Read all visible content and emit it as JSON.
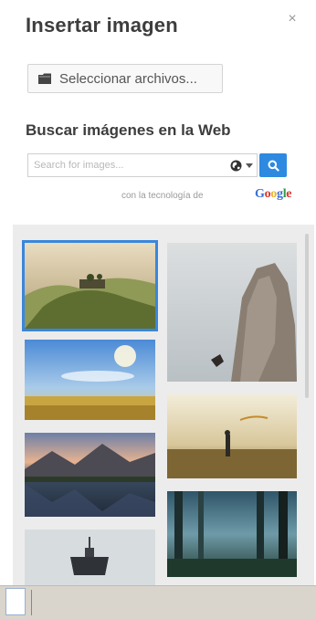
{
  "dialog": {
    "title": "Insertar imagen",
    "close_symbol": "×"
  },
  "upload": {
    "label": "Seleccionar archivos...",
    "icon": "folder-icon"
  },
  "web_search": {
    "heading": "Buscar imágenes en la Web",
    "placeholder": "Search for images...",
    "safe_search_icon": "globe-icon",
    "button_icon": "search-icon",
    "powered_by": "con la tecnología de",
    "provider": "Google"
  },
  "colors": {
    "accent": "#2d8ae0",
    "selection": "#3a86dd",
    "gallery_bg": "#ececec"
  },
  "gallery": {
    "images": [
      {
        "name": "tuscany-hill-villa",
        "selected": true
      },
      {
        "name": "rock-cliff-climber",
        "selected": false
      },
      {
        "name": "wheat-field-sky",
        "selected": false
      },
      {
        "name": "person-field-sunset",
        "selected": false
      },
      {
        "name": "mountain-lake-reflection",
        "selected": false
      },
      {
        "name": "misty-forest",
        "selected": false
      },
      {
        "name": "boat-mist",
        "selected": false
      }
    ]
  }
}
